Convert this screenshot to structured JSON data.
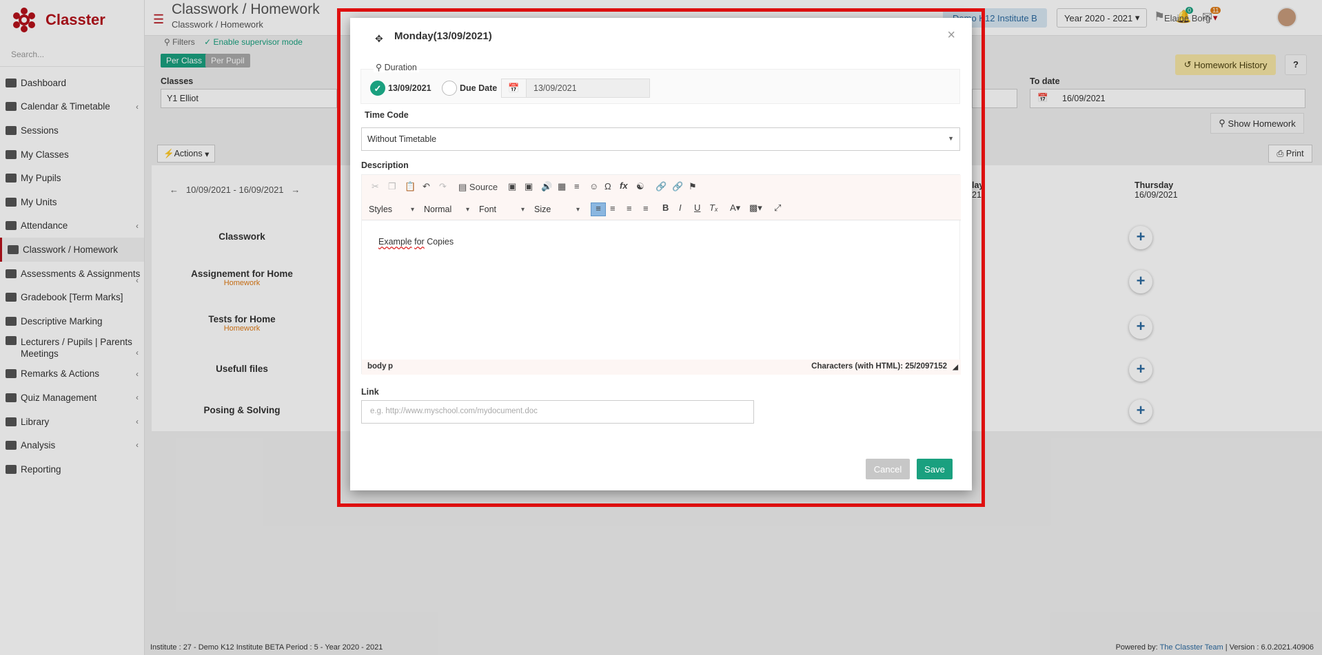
{
  "app": {
    "name": "Classter",
    "search_placeholder": "Search..."
  },
  "sidebar": {
    "items": [
      {
        "label": "Dashboard",
        "chevron": false
      },
      {
        "label": "Calendar & Timetable",
        "chevron": true
      },
      {
        "label": "Sessions",
        "chevron": false
      },
      {
        "label": "My Classes",
        "chevron": false
      },
      {
        "label": "My Pupils",
        "chevron": false
      },
      {
        "label": "My Units",
        "chevron": false
      },
      {
        "label": "Attendance",
        "chevron": true
      },
      {
        "label": "Classwork / Homework",
        "chevron": false,
        "active": true
      },
      {
        "label": "Assessments & Assignments",
        "chevron": true
      },
      {
        "label": "Gradebook [Term Marks]",
        "chevron": false
      },
      {
        "label": "Descriptive Marking",
        "chevron": false
      },
      {
        "label": "Lecturers / Pupils | Parents Meetings",
        "chevron": true
      },
      {
        "label": "Remarks & Actions",
        "chevron": true
      },
      {
        "label": "Quiz Management",
        "chevron": true
      },
      {
        "label": "Library",
        "chevron": true
      },
      {
        "label": "Analysis",
        "chevron": true
      },
      {
        "label": "Reporting",
        "chevron": false
      }
    ]
  },
  "header": {
    "title": "Classwork / Homework",
    "breadcrumb": "Classwork / Homework",
    "institute": "Demo K12 Institute B",
    "year": "Year 2020 - 2021",
    "user": "Elaine Borg",
    "bell_count": "0",
    "mail_count": "11"
  },
  "background": {
    "filters": "Filters",
    "supervisor": "Enable supervisor mode",
    "per_class": "Per Class",
    "per_pupil": "Per Pupil",
    "classes_label": "Classes",
    "classes_value": "Y1 Elliot",
    "to_date_label": "To date",
    "to_date_value": "16/09/2021",
    "homework_history": "Homework History",
    "help": "?",
    "show_homework": "Show Homework",
    "actions": "Actions",
    "print": "Print",
    "week_range": "10/09/2021 - 16/09/2021",
    "partial_day": "lay",
    "partial_date": "21",
    "thursday": "Thursday",
    "thursday_date": "16/09/2021",
    "rows": [
      {
        "label": "Classwork",
        "sub": ""
      },
      {
        "label": "Assignement for Home",
        "sub": "Homework"
      },
      {
        "label": "Tests for Home",
        "sub": "Homework"
      },
      {
        "label": "Usefull files",
        "sub": ""
      },
      {
        "label": "Posing & Solving",
        "sub": ""
      }
    ]
  },
  "footer": {
    "left": "Institute : 27 - Demo K12 Institute BETA Period : 5 - Year 2020 - 2021",
    "powered": "Powered by:",
    "team": "The Classter Team",
    "version": "| Version : 6.0.2021.40906"
  },
  "modal": {
    "title": "Monday(13/09/2021)",
    "duration_legend": "Duration",
    "opt_date": "13/09/2021",
    "opt_due": "Due Date",
    "due_value": "13/09/2021",
    "time_code_label": "Time Code",
    "time_code_value": "Without Timetable",
    "description_label": "Description",
    "toolbar": {
      "source": "Source",
      "styles": "Styles",
      "format": "Normal",
      "font": "Font",
      "size": "Size"
    },
    "content_word1": "Example",
    "content_word2": "for",
    "content_rest": "Copies",
    "path_body": "body",
    "path_p": "p",
    "char_count": "Characters (with HTML): 25/2097152",
    "link_label": "Link",
    "link_placeholder": "e.g. http://www.myschool.com/mydocument.doc",
    "cancel": "Cancel",
    "save": "Save"
  },
  "colors": {
    "brand": "#b5121b",
    "accent": "#1aa07f",
    "highlight": "#e01010"
  }
}
